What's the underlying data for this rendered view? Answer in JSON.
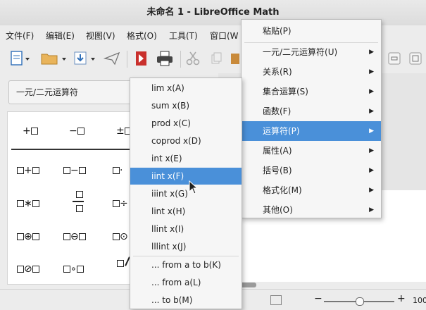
{
  "window": {
    "title": "未命名 1 - LibreOffice Math"
  },
  "menubar": {
    "items": [
      "文件(F)",
      "编辑(E)",
      "视图(V)",
      "格式(O)",
      "工具(T)",
      "窗口(W"
    ]
  },
  "toolbar": {
    "icons": [
      "new-document-icon",
      "open-folder-icon",
      "save-icon",
      "send-icon",
      "export-pdf-icon",
      "print-icon",
      "cut-icon",
      "copy-icon",
      "paste-icon"
    ]
  },
  "elements_panel": {
    "category": "一元/二元运算符",
    "row1": [
      "+□",
      "−□",
      "±□"
    ],
    "grid": [
      [
        "□+□",
        "□−□",
        "□·"
      ],
      [
        "□∗□",
        "fraction",
        "□÷"
      ],
      [
        "□⊕□",
        "□⊖□",
        "□⊙"
      ],
      [
        "□⊘□",
        "□∘□",
        "slash"
      ]
    ]
  },
  "context_menu": {
    "items": [
      {
        "label": "粘贴(P)",
        "submenu": false
      },
      {
        "label": "一元/二元运算符(U)",
        "submenu": true
      },
      {
        "label": "关系(R)",
        "submenu": true
      },
      {
        "label": "集合运算(S)",
        "submenu": true
      },
      {
        "label": "函数(F)",
        "submenu": true
      },
      {
        "label": "运算符(P)",
        "submenu": true,
        "active": true
      },
      {
        "label": "属性(A)",
        "submenu": true
      },
      {
        "label": "括号(B)",
        "submenu": true
      },
      {
        "label": "格式化(M)",
        "submenu": true
      },
      {
        "label": "其他(O)",
        "submenu": true
      }
    ]
  },
  "operators_submenu": {
    "items": [
      "lim x(A)",
      "sum x(B)",
      "prod x(C)",
      "coprod x(D)",
      "int x(E)",
      "iint x(F)",
      "iiint x(G)",
      "lint x(H)",
      "llint x(I)",
      "lllint x(J)",
      "... from a to b(K)",
      "... from a(L)",
      "... to b(M)"
    ],
    "active_index": 5
  },
  "statusbar": {
    "zoom_minus": "−",
    "zoom_plus": "+",
    "zoom_value": "100",
    "zoom_slider_level": 0.5
  },
  "colors": {
    "highlight": "#4a90d9"
  }
}
